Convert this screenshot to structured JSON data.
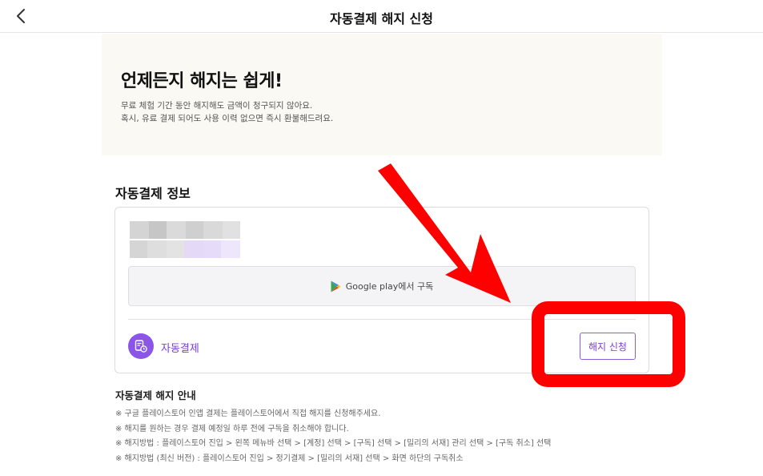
{
  "header": {
    "title": "자동결제 해지 신청"
  },
  "hero": {
    "title": "언제든지 해지는 쉽게!",
    "desc": [
      "무료 체험 기간 동안 해지해도 금액이 청구되지 않아요.",
      "혹시, 유료 결제 되어도 사용 이력 없으면 즉시 환불해드려요."
    ]
  },
  "section": {
    "title": "자동결제 정보"
  },
  "card": {
    "google_play_label": "Google play에서 구독",
    "auto_pay_label": "자동결제",
    "cancel_button_label": "해지 신청"
  },
  "guide": {
    "title": "자동결제 해지 안내",
    "items": [
      "※ 구글 플레이스토어 인앱 결제는 플레이스토어에서 직접 해지를 신청해주세요.",
      "※ 해지를 원하는 경우 결제 예정일 하루 전에 구독을 취소해야 합니다.",
      "※ 해지방법 : 플레이스토어 진입 > 왼쪽 메뉴바 선택 > [계정] 선택 > [구독] 선택 > [밀리의 서재] 관리 선택 > [구독 취소] 선택",
      "※ 해지방법 (최신 버전) : 플레이스토어 진입 > 정기결제 > [밀리의 서재] 선택 > 화면 하단의 구독취소"
    ]
  },
  "colors": {
    "accent": "#7a3fd8",
    "annotation_red": "#ff0000",
    "hero_bg": "#faf9f3"
  },
  "icons": {
    "back": "chevron-left-icon",
    "play": "google-play-icon",
    "auto_pay": "payment-clock-icon"
  }
}
